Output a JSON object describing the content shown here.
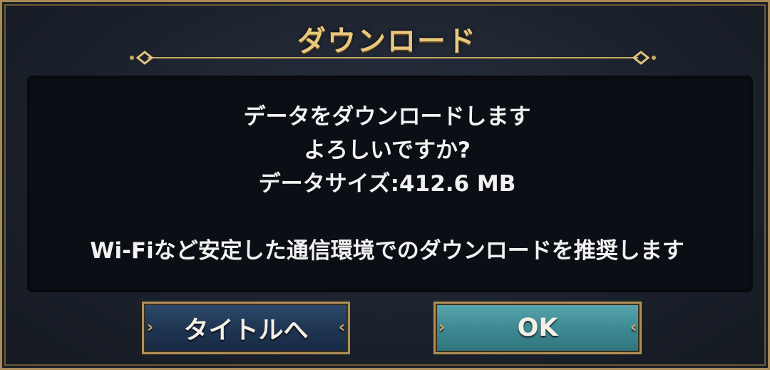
{
  "dialog": {
    "title": "ダウンロード",
    "message_lines": [
      "データをダウンロードします",
      "よろしいですか?",
      "データサイズ:412.6 MB"
    ],
    "recommendation": "Wi-Fiなど安定した通信環境でのダウンロードを推奨します"
  },
  "buttons": {
    "back_label": "タイトルへ",
    "ok_label": "OK"
  },
  "colors": {
    "gold": "#e9c87e",
    "frame": "#a88a54",
    "btn_blue": "#1f3552",
    "btn_teal": "#3e8a94"
  }
}
